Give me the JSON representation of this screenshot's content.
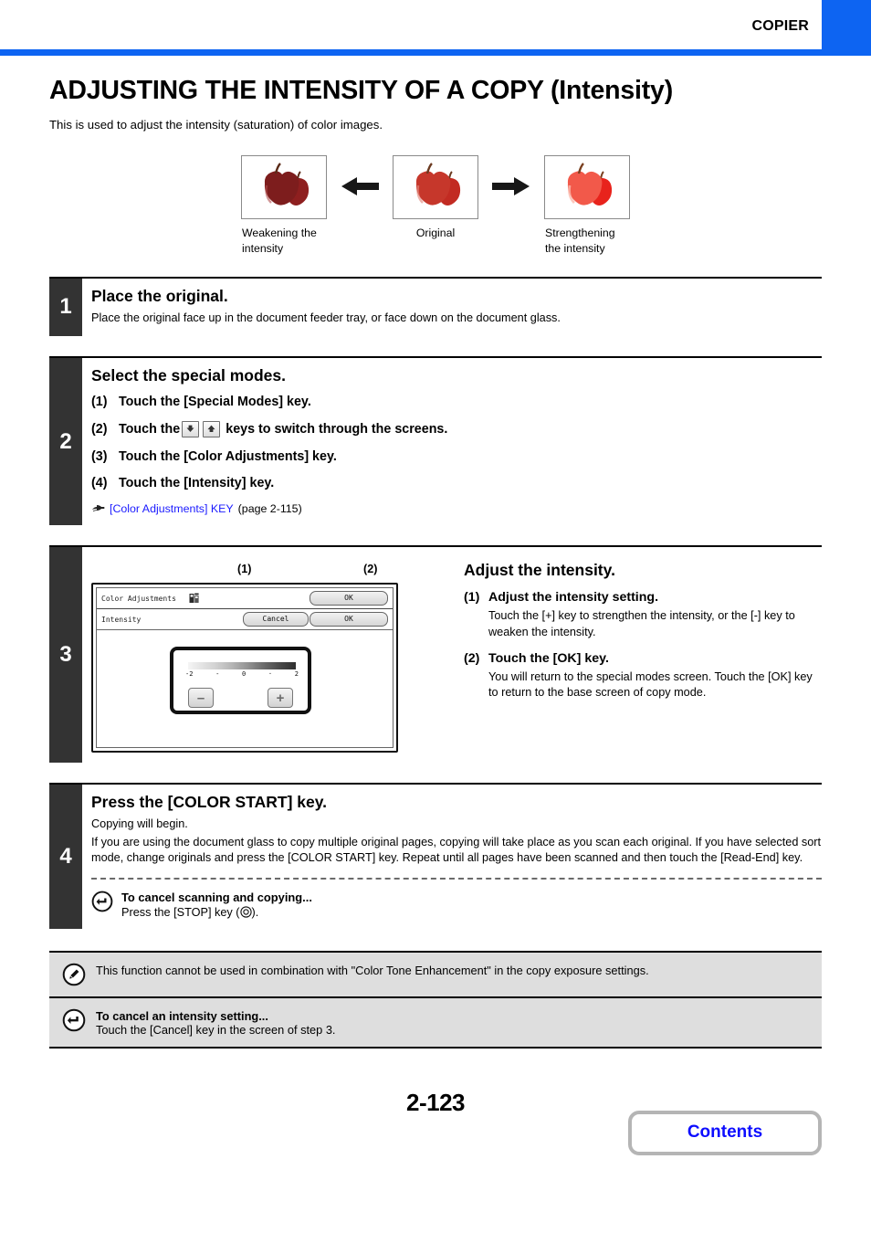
{
  "header": {
    "section_label": "COPIER",
    "accent_color": "#0d64f2"
  },
  "title": "ADJUSTING THE INTENSITY OF A COPY (Intensity)",
  "intro": "This is used to adjust the intensity (saturation) of color images.",
  "figure": {
    "items": [
      {
        "caption": "Weakening the intensity",
        "icon": "apples-dark-icon"
      },
      {
        "caption": "Original",
        "icon": "apples-normal-icon"
      },
      {
        "caption": "Strengthening the intensity",
        "icon": "apples-bright-icon"
      }
    ],
    "arrow_left": "arrow-left-icon",
    "arrow_right": "arrow-right-icon"
  },
  "steps": [
    {
      "number": "1",
      "title": "Place the original.",
      "text": "Place the original face up in the document feeder tray, or face down on the document glass."
    },
    {
      "number": "2",
      "title": "Select the special modes.",
      "items": [
        {
          "mark": "(1)",
          "text_before": "Touch the [Special Modes] key.",
          "text_after": ""
        },
        {
          "mark": "(2)",
          "text_before": "Touch the",
          "text_after": "keys to switch through the screens."
        },
        {
          "mark": "(3)",
          "text_before": "Touch the [Color Adjustments] key.",
          "text_after": ""
        },
        {
          "mark": "(4)",
          "text_before": "Touch the [Intensity] key.",
          "text_after": ""
        }
      ],
      "xref_link": "[Color Adjustments] KEY",
      "xref_page": "(page 2-115)"
    },
    {
      "number": "3",
      "title": "Adjust the intensity.",
      "items": [
        {
          "mark": "(1)",
          "title": "Adjust the intensity setting.",
          "text": "Touch the [+] key to strengthen the intensity, or the [-] key to weaken the intensity."
        },
        {
          "mark": "(2)",
          "title": "Touch the [OK] key.",
          "text": "You will return to the special modes screen. Touch the [OK] key to return to the base screen of copy mode."
        }
      ]
    },
    {
      "number": "4",
      "title": "Press the [COLOR START] key.",
      "line1": "Copying will begin.",
      "line2": "If you are using the document glass to copy multiple original pages, copying will take place as you scan each original. If you have selected sort mode, change originals and press the [COLOR START] key. Repeat until all pages have been scanned and then touch the [Read-End] key.",
      "tip_title": "To cancel scanning and copying...",
      "tip_text_before": "Press the [STOP] key (",
      "tip_text_after": ")."
    }
  ],
  "lcd": {
    "callout_1": "(1)",
    "callout_2": "(2)",
    "title_row": {
      "label": "Color Adjustments",
      "icon": "color-adjust-icon",
      "ok_label": "OK"
    },
    "sub_row": {
      "label": "Intensity",
      "cancel_label": "Cancel",
      "ok_label": "OK"
    },
    "scale": {
      "ticks": [
        "-2",
        "-",
        "0",
        "·",
        "2"
      ]
    },
    "minus_label": "–",
    "plus_label": "+"
  },
  "notes": [
    {
      "icon": "pencil-note-icon",
      "bold_line": "",
      "line": "This function cannot be used in combination with \"Color Tone Enhancement\" in the copy exposure settings."
    },
    {
      "icon": "return-arrow-icon",
      "bold_line": "To cancel an intensity setting...",
      "line": "Touch the [Cancel] key in the screen of step 3."
    }
  ],
  "footer": {
    "page_number": "2-123",
    "contents_label": "Contents"
  }
}
